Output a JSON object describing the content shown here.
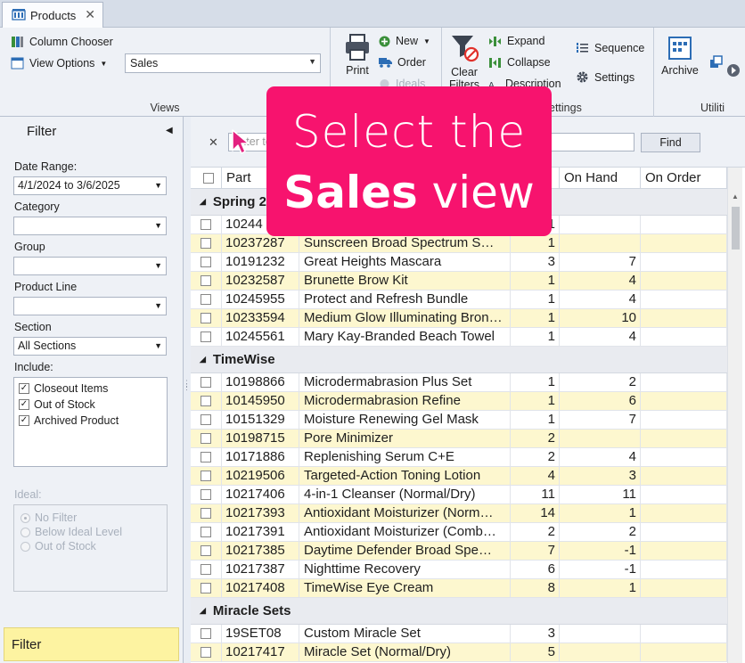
{
  "tab": {
    "title": "Products",
    "close": "✕"
  },
  "ribbon": {
    "views": {
      "column_chooser": "Column Chooser",
      "view_options": "View Options",
      "view_select": "Sales",
      "label": "Views"
    },
    "actions": {
      "print": "Print",
      "new": "New",
      "order": "Order",
      "ideals": "Ideals"
    },
    "grid": {
      "clear_filters": "Clear Filters",
      "expand": "Expand",
      "collapse": "Collapse",
      "description": "Description",
      "sequence": "Sequence",
      "settings": "Settings",
      "settings_group": "ettings"
    },
    "utilities": {
      "archive": "Archive",
      "label": "Utiliti"
    }
  },
  "filter": {
    "title": "Filter",
    "date_range_label": "Date Range:",
    "date_range_value": "4/1/2024 to 3/6/2025",
    "category_label": "Category",
    "category_value": "",
    "group_label": "Group",
    "group_value": "",
    "product_line_label": "Product Line",
    "product_line_value": "",
    "section_label": "Section",
    "section_value": "All Sections",
    "include_label": "Include:",
    "include": [
      {
        "label": "Closeout Items",
        "checked": true
      },
      {
        "label": "Out of Stock",
        "checked": true
      },
      {
        "label": "Archived Product",
        "checked": true
      }
    ],
    "ideal_label": "Ideal:",
    "ideal_options": [
      {
        "label": "No Filter",
        "selected": true
      },
      {
        "label": "Below Ideal Level",
        "selected": false
      },
      {
        "label": "Out of Stock",
        "selected": false
      }
    ],
    "button": "Filter"
  },
  "search": {
    "placeholder": "Enter te",
    "find": "Find",
    "clear": "✕"
  },
  "grid": {
    "columns": [
      "Part",
      "",
      "",
      "On Hand",
      "On Order"
    ],
    "groups": [
      {
        "name": "Spring 2",
        "rows": [
          {
            "part": "10244",
            "desc": "",
            "qty": "1",
            "on_hand": ""
          },
          {
            "part": "10237287",
            "desc": "Sunscreen Broad Spectrum S…",
            "qty": "1",
            "on_hand": ""
          },
          {
            "part": "10191232",
            "desc": "Great Heights Mascara",
            "qty": "3",
            "on_hand": "7"
          },
          {
            "part": "10232587",
            "desc": "Brunette Brow Kit",
            "qty": "1",
            "on_hand": "4"
          },
          {
            "part": "10245955",
            "desc": "Protect and Refresh Bundle",
            "qty": "1",
            "on_hand": "4"
          },
          {
            "part": "10233594",
            "desc": "Medium Glow Illuminating Bron…",
            "qty": "1",
            "on_hand": "10"
          },
          {
            "part": "10245561",
            "desc": "Mary Kay-Branded Beach Towel",
            "qty": "1",
            "on_hand": "4"
          }
        ]
      },
      {
        "name": "TimeWise",
        "rows": [
          {
            "part": "10198866",
            "desc": "Microdermabrasion Plus Set",
            "qty": "1",
            "on_hand": "2"
          },
          {
            "part": "10145950",
            "desc": "Microdermabrasion Refine",
            "qty": "1",
            "on_hand": "6"
          },
          {
            "part": "10151329",
            "desc": "Moisture Renewing Gel Mask",
            "qty": "1",
            "on_hand": "7"
          },
          {
            "part": "10198715",
            "desc": "Pore Minimizer",
            "qty": "2",
            "on_hand": ""
          },
          {
            "part": "10171886",
            "desc": "Replenishing Serum C+E",
            "qty": "2",
            "on_hand": "4"
          },
          {
            "part": "10219506",
            "desc": "Targeted-Action Toning Lotion",
            "qty": "4",
            "on_hand": "3"
          },
          {
            "part": "10217406",
            "desc": "4-in-1 Cleanser (Normal/Dry)",
            "qty": "11",
            "on_hand": "11"
          },
          {
            "part": "10217393",
            "desc": "Antioxidant Moisturizer (Norm…",
            "qty": "14",
            "on_hand": "1"
          },
          {
            "part": "10217391",
            "desc": "Antioxidant Moisturizer (Comb…",
            "qty": "2",
            "on_hand": "2"
          },
          {
            "part": "10217385",
            "desc": "Daytime Defender Broad Spe…",
            "qty": "7",
            "on_hand": "-1"
          },
          {
            "part": "10217387",
            "desc": "Nighttime Recovery",
            "qty": "6",
            "on_hand": "-1"
          },
          {
            "part": "10217408",
            "desc": "TimeWise Eye Cream",
            "qty": "8",
            "on_hand": "1"
          }
        ]
      },
      {
        "name": "Miracle Sets",
        "rows": [
          {
            "part": "19SET08",
            "desc": "Custom Miracle Set",
            "qty": "3",
            "on_hand": ""
          },
          {
            "part": "10217417",
            "desc": "Miracle Set (Normal/Dry)",
            "qty": "5",
            "on_hand": ""
          }
        ]
      }
    ]
  },
  "callout": {
    "line1": "Select the",
    "line2_bold": "Sales",
    "line2_rest": " view"
  },
  "colors": {
    "accent": "#f7136e",
    "row_alt": "#fdf7cf",
    "filter_button": "#fdf3a1"
  }
}
